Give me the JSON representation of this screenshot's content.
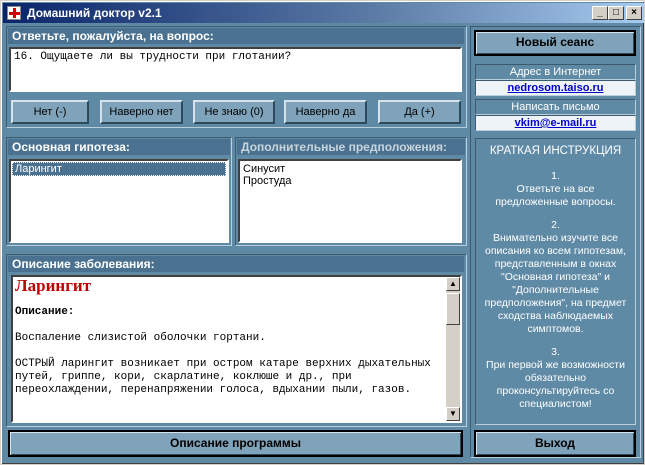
{
  "window": {
    "title": "Домашний доктор v2.1"
  },
  "question": {
    "header": "Ответьте, пожалуйста, на вопрос:",
    "text": "16. Ощущаете ли вы трудности при глотании?"
  },
  "answers": [
    "Нет (-)",
    "Наверно нет",
    "Не знаю (0)",
    "Наверно да",
    "Да (+)"
  ],
  "main_hypothesis": {
    "header": "Основная гипотеза:",
    "items": [
      "Ларингит"
    ]
  },
  "extra_hypotheses": {
    "header": "Дополнительные предположения:",
    "items": [
      "Синусит",
      "Простуда"
    ]
  },
  "description": {
    "header": "Описание заболевания:",
    "title": "Ларингит",
    "label": "Описание:",
    "para1": "Воспаление слизистой оболочки гортани.",
    "para2": "ОСТРЫЙ ларингит возникает при остром катаре верхних  дыхательных путей, гриппе, кори, скарлатине, коклюше и др., при переохлаждении, перенапряжении голоса, вдыхании пыли, газов."
  },
  "about_button": "Описание программы",
  "sidebar": {
    "new_session": "Новый сеанс",
    "address_label": "Адрес в Интернет",
    "address_link": "nedrosom.taiso.ru",
    "mail_label": "Написать письмо",
    "mail_link": "vkim@e-mail.ru",
    "instructions_title": "КРАТКАЯ ИНСТРУКЦИЯ",
    "step1_num": "1.",
    "step1": "Ответьте на все предложенные вопросы.",
    "step2_num": "2.",
    "step2": "Внимательно изучите все описания ко всем гипотезам, представленным в окнах \"Основная гипотеза\" и \"Дополнительные предположения\", на предмет сходства наблюдаемых симптомов.",
    "step3_num": "3.",
    "step3": "При первой же возможности обязательно проконсультируйтесь со специалистом!",
    "exit": "Выход"
  },
  "colors": {
    "background": "#5f8aa5",
    "header": "#4a7290",
    "title_red": "#c00000"
  }
}
